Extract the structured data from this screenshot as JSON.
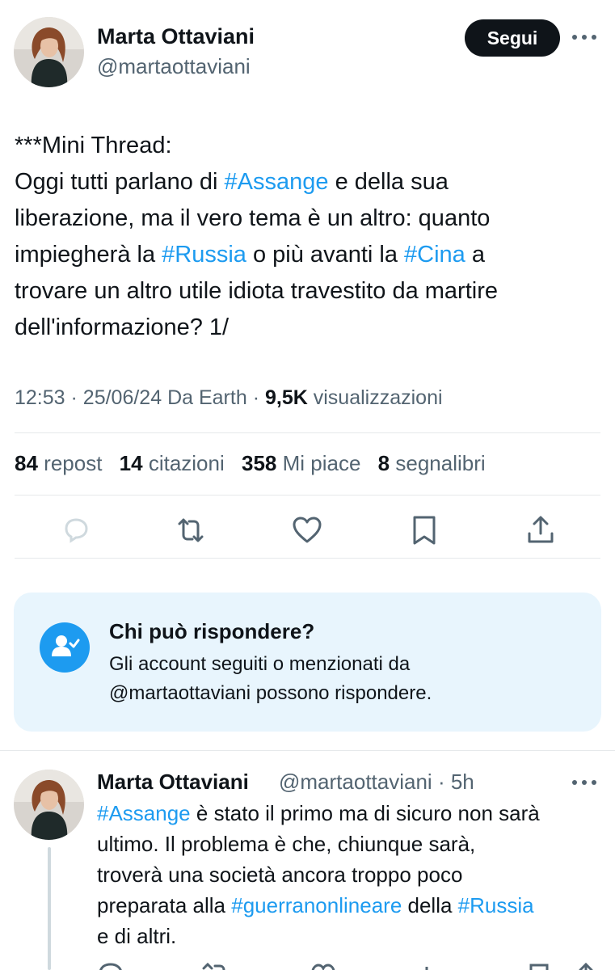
{
  "tweet": {
    "author_name": "Marta Ottaviani",
    "author_handle": "@martaottaviani",
    "follow_label": "Segui",
    "text_lines": [
      [
        {
          "t": "***Mini Thread:",
          "tag": false
        }
      ],
      [
        {
          "t": "Oggi tutti parlano di ",
          "tag": false
        },
        {
          "t": "#Assange",
          "tag": true
        },
        {
          "t": " e della sua",
          "tag": false
        }
      ],
      [
        {
          "t": "liberazione, ma il vero tema è un altro: quanto",
          "tag": false
        }
      ],
      [
        {
          "t": "impiegherà la ",
          "tag": false
        },
        {
          "t": "#Russia",
          "tag": true
        },
        {
          "t": " o più avanti la ",
          "tag": false
        },
        {
          "t": "#Cina",
          "tag": true
        },
        {
          "t": " a",
          "tag": false
        }
      ],
      [
        {
          "t": "trovare un altro utile idiota travestito da martire",
          "tag": false
        }
      ],
      [
        {
          "t": "dell'informazione? 1/",
          "tag": false
        }
      ]
    ],
    "time": "12:53",
    "date": "25/06/24",
    "source": "Da Earth",
    "views_count": "9,5K",
    "views_label": "visualizzazioni"
  },
  "stats": {
    "reposts_count": "84",
    "reposts_label": "repost",
    "quotes_count": "14",
    "quotes_label": "citazioni",
    "likes_count": "358",
    "likes_label": "Mi piace",
    "bookmarks_count": "8",
    "bookmarks_label": "segnalibri"
  },
  "actions": [
    "reply-icon",
    "repost-icon",
    "like-icon",
    "bookmark-icon",
    "share-icon"
  ],
  "reply_restriction": {
    "title": "Chi può rispondere?",
    "line1": "Gli account seguiti o menzionati da",
    "line2": "@martaottaviani possono rispondere."
  },
  "reply_tweet": {
    "author_name": "Marta Ottaviani",
    "author_handle": "@martaottaviani",
    "time_ago": "5h",
    "text_lines": [
      [
        {
          "t": "#Assange",
          "tag": true
        },
        {
          "t": " è stato il primo ma di sicuro non sarà",
          "tag": false
        }
      ],
      [
        {
          "t": "ultimo. Il problema è che, chiunque sarà,",
          "tag": false
        }
      ],
      [
        {
          "t": "troverà una società ancora troppo poco",
          "tag": false
        }
      ],
      [
        {
          "t": "preparata alla ",
          "tag": false
        },
        {
          "t": "#guerranonlineare",
          "tag": true
        },
        {
          "t": " della ",
          "tag": false
        },
        {
          "t": "#Russia",
          "tag": true
        }
      ],
      [
        {
          "t": "e di altri.",
          "tag": false
        }
      ]
    ]
  },
  "colors": {
    "accent": "#1d9bf0",
    "text": "#0f1419",
    "secondary": "#536471",
    "reply_box_bg": "#e8f5fd"
  }
}
